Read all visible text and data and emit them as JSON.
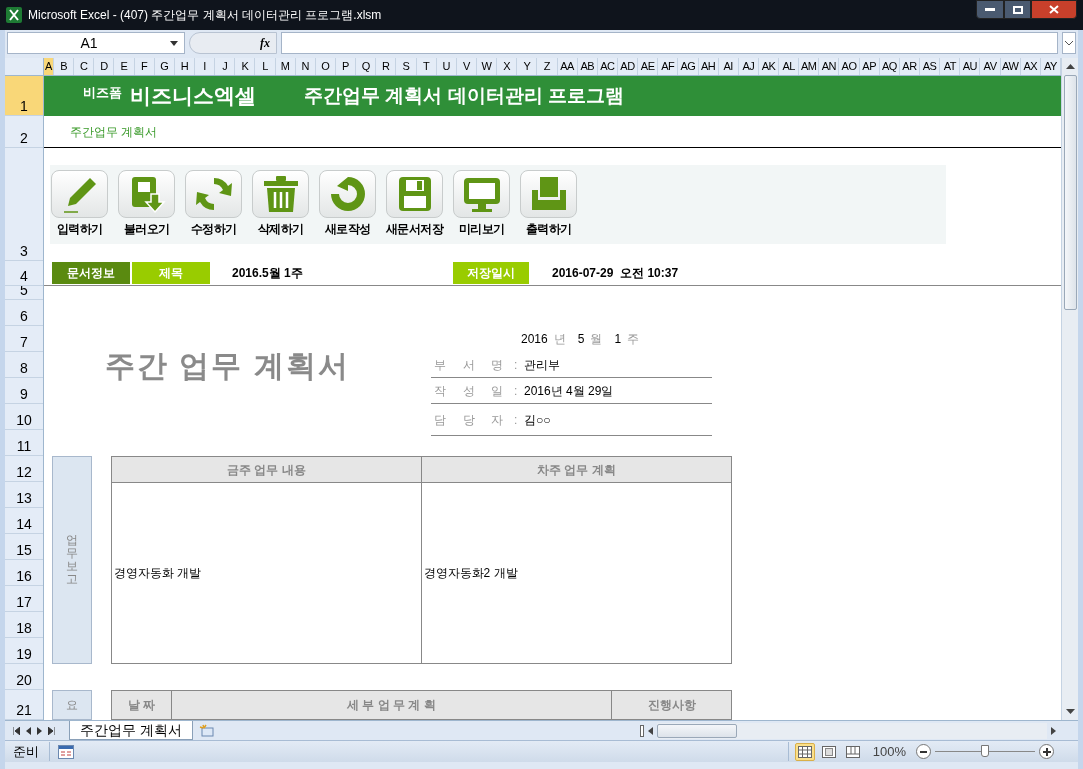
{
  "window": {
    "title": "Microsoft Excel - (407) 주간업무 계획서 데이터관리 프로그램.xlsm"
  },
  "formula_bar": {
    "name_box": "A1",
    "function_label": "fx"
  },
  "column_headers": [
    {
      "label": "A",
      "selected": true
    },
    {
      "label": "B",
      "selected": false
    },
    {
      "label": "C",
      "selected": false
    },
    {
      "label": "D",
      "selected": false
    },
    {
      "label": "E",
      "selected": false
    },
    {
      "label": "F",
      "selected": false
    },
    {
      "label": "G",
      "selected": false
    },
    {
      "label": "H",
      "selected": false
    },
    {
      "label": "I",
      "selected": false
    },
    {
      "label": "J",
      "selected": false
    },
    {
      "label": "K",
      "selected": false
    },
    {
      "label": "L",
      "selected": false
    },
    {
      "label": "M",
      "selected": false
    },
    {
      "label": "N",
      "selected": false
    },
    {
      "label": "O",
      "selected": false
    },
    {
      "label": "P",
      "selected": false
    },
    {
      "label": "Q",
      "selected": false
    },
    {
      "label": "R",
      "selected": false
    },
    {
      "label": "S",
      "selected": false
    },
    {
      "label": "T",
      "selected": false
    },
    {
      "label": "U",
      "selected": false
    },
    {
      "label": "V",
      "selected": false
    },
    {
      "label": "W",
      "selected": false
    },
    {
      "label": "X",
      "selected": false
    },
    {
      "label": "Y",
      "selected": false
    },
    {
      "label": "Z",
      "selected": false
    },
    {
      "label": "AA",
      "selected": false
    },
    {
      "label": "AB",
      "selected": false
    },
    {
      "label": "AC",
      "selected": false
    },
    {
      "label": "AD",
      "selected": false
    },
    {
      "label": "AE",
      "selected": false
    },
    {
      "label": "AF",
      "selected": false
    },
    {
      "label": "AG",
      "selected": false
    },
    {
      "label": "AH",
      "selected": false
    },
    {
      "label": "AI",
      "selected": false
    },
    {
      "label": "AJ",
      "selected": false
    },
    {
      "label": "AK",
      "selected": false
    },
    {
      "label": "AL",
      "selected": false
    },
    {
      "label": "AM",
      "selected": false
    },
    {
      "label": "AN",
      "selected": false
    },
    {
      "label": "AO",
      "selected": false
    },
    {
      "label": "AP",
      "selected": false
    },
    {
      "label": "AQ",
      "selected": false
    },
    {
      "label": "AR",
      "selected": false
    },
    {
      "label": "AS",
      "selected": false
    },
    {
      "label": "AT",
      "selected": false
    },
    {
      "label": "AU",
      "selected": false
    },
    {
      "label": "AV",
      "selected": false
    },
    {
      "label": "AW",
      "selected": false
    },
    {
      "label": "AX",
      "selected": false
    },
    {
      "label": "AY",
      "selected": false
    }
  ],
  "row_headers": [
    {
      "label": "1",
      "selected": true
    },
    {
      "label": "2",
      "selected": false
    },
    {
      "label": "3",
      "selected": false
    },
    {
      "label": "4",
      "selected": false
    },
    {
      "label": "5",
      "selected": false
    },
    {
      "label": "6",
      "selected": false
    },
    {
      "label": "7",
      "selected": false
    },
    {
      "label": "8",
      "selected": false
    },
    {
      "label": "9",
      "selected": false
    },
    {
      "label": "10",
      "selected": false
    },
    {
      "label": "11",
      "selected": false
    },
    {
      "label": "12",
      "selected": false
    },
    {
      "label": "13",
      "selected": false
    },
    {
      "label": "14",
      "selected": false
    },
    {
      "label": "15",
      "selected": false
    },
    {
      "label": "16",
      "selected": false
    },
    {
      "label": "17",
      "selected": false
    },
    {
      "label": "18",
      "selected": false
    },
    {
      "label": "19",
      "selected": false
    },
    {
      "label": "20",
      "selected": false
    },
    {
      "label": "21",
      "selected": false
    }
  ],
  "banner": {
    "brand_small": "비즈폼",
    "brand": "비즈니스엑셀",
    "title": "주간업무 계획서 데이터관리 프로그램"
  },
  "subtitle": "주간업무 계획서",
  "toolbar": [
    {
      "label": "입력하기",
      "kind": "pencil"
    },
    {
      "label": "불러오기",
      "kind": "load"
    },
    {
      "label": "수정하기",
      "kind": "refresh"
    },
    {
      "label": "삭제하기",
      "kind": "trash"
    },
    {
      "label": "새로작성",
      "kind": "reset"
    },
    {
      "label": "새문서저장",
      "kind": "save"
    },
    {
      "label": "미리보기",
      "kind": "monitor"
    },
    {
      "label": "출력하기",
      "kind": "print"
    }
  ],
  "info_bar": {
    "section_label": "문서정보",
    "title_label": "제목",
    "title_value": "2016.5월 1주",
    "saved_label": "저장일시",
    "saved_value": "2016-07-29  오전 10:37"
  },
  "document": {
    "heading": "주간 업무 계획서",
    "week": {
      "year": "2016",
      "year_unit": "년",
      "month": "5",
      "month_unit": "월",
      "week": "1",
      "week_unit": "주"
    },
    "fields": [
      {
        "label": "부 서 명",
        "colon": ":",
        "value": "관리부"
      },
      {
        "label": "작 성 일",
        "colon": ":",
        "value": "2016년 4월 29일"
      },
      {
        "label": "담 당 자",
        "colon": ":",
        "value": "김○○"
      }
    ]
  },
  "report": {
    "side_label": "업무보고",
    "columns": [
      "금주 업무 내용",
      "차주 업무 계획"
    ],
    "cells": [
      "경영자동화 개발",
      "경영자동화2 개발"
    ]
  },
  "detail": {
    "side_label": "요",
    "columns": [
      "날 짜",
      "세 부 업 무 계 획",
      "진행사항"
    ]
  },
  "sheet_tabs": [
    {
      "label": "주간업무 계획서",
      "selected": true
    }
  ],
  "status_bar": {
    "status": "준비",
    "views": [
      {
        "kind": "normal",
        "selected": true
      },
      {
        "kind": "layout",
        "selected": false
      },
      {
        "kind": "pagebreak",
        "selected": false
      }
    ],
    "zoom": "100%",
    "zoom_slider": {
      "level": 0.5
    }
  }
}
